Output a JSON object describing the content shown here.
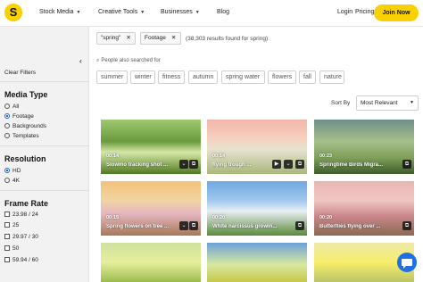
{
  "nav": {
    "stock_media": "Stock Media",
    "creative_tools": "Creative Tools",
    "businesses": "Businesses",
    "blog": "Blog",
    "login": "Login",
    "pricing": "Pricing",
    "join": "Join Now",
    "logo_letter": "S"
  },
  "sidebar": {
    "collapse_icon": "chevron-left-icon",
    "clear_filters": "Clear Filters",
    "media_type": {
      "title": "Media Type",
      "options": [
        "All",
        "Footage",
        "Backgrounds",
        "Templates"
      ],
      "selected": "Footage"
    },
    "resolution": {
      "title": "Resolution",
      "options": [
        "HD",
        "4K"
      ],
      "selected": "HD"
    },
    "frame_rate": {
      "title": "Frame Rate",
      "options": [
        "23.98 / 24",
        "25",
        "29.97 / 30",
        "50",
        "59.94 / 60"
      ]
    }
  },
  "filters": {
    "chips": [
      "\"spring\"",
      "Footage"
    ],
    "results": "(38,303 results found for spring)"
  },
  "suggestions": {
    "label": "People also searched for",
    "items": [
      "summer",
      "winter",
      "fitness",
      "autumn",
      "spring water",
      "flowers",
      "fall",
      "nature"
    ]
  },
  "sort": {
    "label": "Sort By",
    "value": "Most Relevant"
  },
  "results_grid": [
    {
      "duration": "00:14",
      "caption": "Slowmo tracking shot ..."
    },
    {
      "duration": "00:14",
      "caption": "flying trough ..."
    },
    {
      "duration": "00:23",
      "caption": "Springtime Birds Migra..."
    },
    {
      "duration": "00:15",
      "caption": "Spring flowers on tree ..."
    },
    {
      "duration": "00:20",
      "caption": "White narcissus growin..."
    },
    {
      "duration": "00:20",
      "caption": "Butterflies flying over ..."
    },
    {
      "duration": "",
      "caption": ""
    },
    {
      "duration": "",
      "caption": ""
    },
    {
      "duration": "",
      "caption": ""
    }
  ],
  "colors": {
    "accent_yellow": "#f7d100",
    "help_blue": "#1f6fe5",
    "radio_blue": "#1d5fe0"
  }
}
